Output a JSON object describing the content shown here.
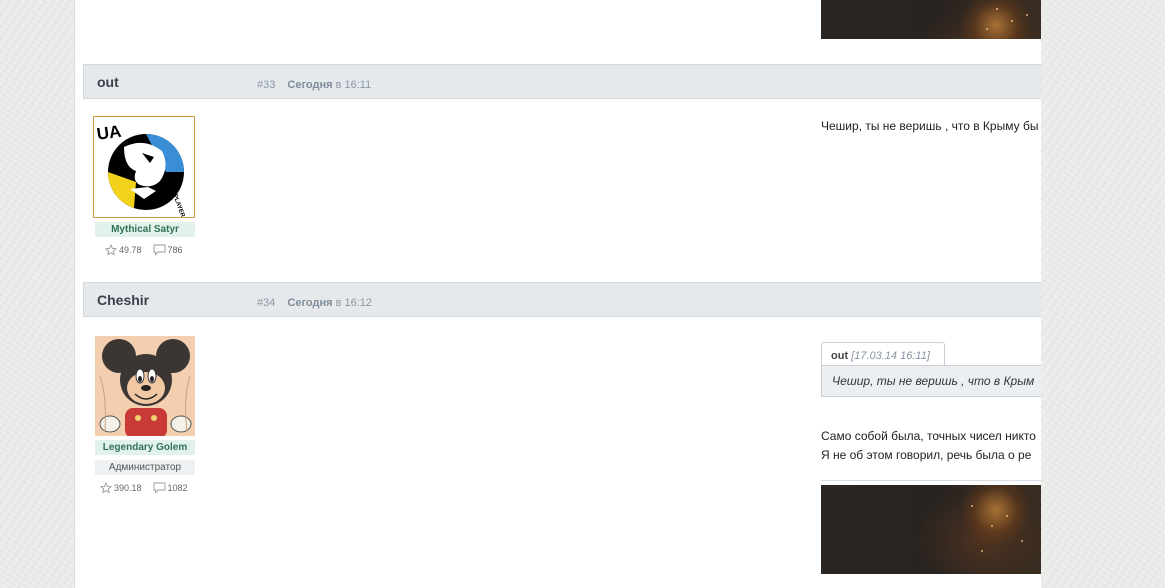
{
  "posts": [
    {
      "author": "out",
      "number": "#33",
      "day": "Сегодня",
      "time_sep": "в 16:11",
      "avatar_icon": "ua-player-logo-icon",
      "rank": "Mythical Satyr",
      "rating": "49.78",
      "messages": "786",
      "text": "Чешир, ты не веришь , что в Крыму бы"
    },
    {
      "author": "Cheshir",
      "number": "#34",
      "day": "Сегодня",
      "time_sep": "в 16:12",
      "avatar_icon": "mickey-mouse-avatar-icon",
      "rank": "Legendary Golem",
      "role": "Администратор",
      "rating": "390.18",
      "messages": "1082",
      "quote": {
        "author": "out",
        "date": "[17.03.14 16:11]",
        "text": "Чешир, ты не веришь , что в Крым"
      },
      "lines": [
        "Само собой была, точных чисел никто",
        "Я не об этом говорил, речь была о ре"
      ]
    }
  ],
  "avatar_logo_text": {
    "top": "UA",
    "side": "PLAYER"
  },
  "colors": {
    "ukraine_blue": "#3a8ed6",
    "ukraine_yellow": "#f2d21b",
    "rank_green": "#317153",
    "header_bg": "#e6e9ec"
  },
  "icons": [
    "star-icon",
    "comment-icon"
  ]
}
